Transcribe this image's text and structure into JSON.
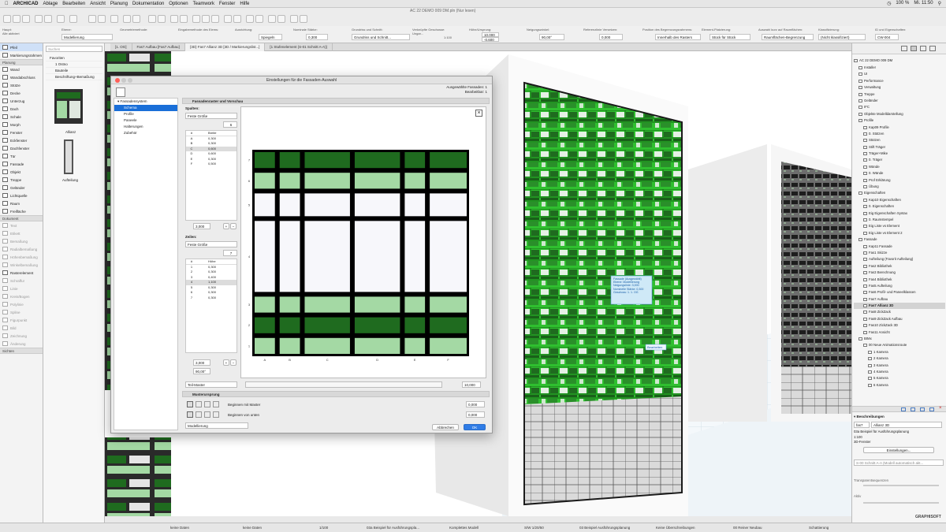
{
  "menubar": {
    "app": "ARCHICAD",
    "items": [
      "Ablage",
      "Bearbeiten",
      "Ansicht",
      "Planung",
      "Dokumentation",
      "Optionen",
      "Teamwork",
      "Fenster",
      "Hilfe"
    ],
    "battery": "100 %",
    "time": "Mi. 11:50"
  },
  "toolbar": {
    "doc_title": "AC 22 DEMO 009 DM.pln (Nur lesen)"
  },
  "infobox": {
    "header_main": "Haupt:",
    "main_value": "Alle aktiviert",
    "ebene_label": "Ebene:",
    "ebene_value": "Modellierung",
    "geom_label": "Geometriemethode:",
    "einsetz_label": "Eingabemethode des Elems:",
    "ausricht_label": "Ausrichtung:",
    "ausricht_value": "Spiegeln",
    "nominal_label": "Nominale Stärke:",
    "nominal_value": "0,300",
    "grundriss_label": "Grundriss und Schnitt:",
    "grundriss_value": "Grundriss und Schnitt...",
    "verknuepfte_label": "Verknüpfte Geschosse:",
    "verknuepfte_value": "Ungar...",
    "massstab_value": "1:100",
    "hoehe_label": "Höhe/Ursprung:",
    "hoehe_value": "10,000",
    "hoehe_value2": "-0,600",
    "neigung_label": "Neigungswinkel:",
    "neigung_value": "90,00°",
    "versatz_label": "Referenzlinie Versetzen:",
    "versatz_value": "0,000",
    "position_label": "Position des Begrenzungsrahmens:",
    "position_value": "Innerhalb des Rasters",
    "platzierung_label": "Element-Platzierung:",
    "platzierung_value": "Stück für Stück",
    "auswahl_label": "Auswahl kurz auf Raumflächen:",
    "auswahl_value": "Raumflächen-Begrenzung",
    "klass_label": "Klassifizierung:",
    "klass_value": "(Nicht klassifiziert)",
    "id_label": "ID und Eigenschaften:",
    "id_value": "CW-004"
  },
  "tabs": [
    {
      "label": "[1. OG]",
      "active": false
    },
    {
      "label": "Fas7 Aufbau [Fas7 Aufbau]",
      "active": false
    },
    {
      "label": "{3D} Fas7 Allianz 3D [3D / Markierungslist...]",
      "active": true
    },
    {
      "label": "[1 Stufenelement (S-01 Schnitt A-A)]",
      "active": false
    }
  ],
  "toolbox": {
    "sections": [
      {
        "title": "",
        "items": [
          {
            "label": "Pfeil",
            "selected": true
          },
          {
            "label": "Markierungsrahmen",
            "dim": false
          }
        ]
      },
      {
        "title": "Planung",
        "items": [
          {
            "label": "Wand"
          },
          {
            "label": "Wandabschluss"
          },
          {
            "label": "Stütze"
          },
          {
            "label": "Decke"
          },
          {
            "label": "Unterzug"
          },
          {
            "label": "Dach"
          },
          {
            "label": "Schale"
          },
          {
            "label": "Morph"
          },
          {
            "label": "Fenster"
          },
          {
            "label": "Eckfenster"
          },
          {
            "label": "Dachfenster"
          },
          {
            "label": "Tür"
          },
          {
            "label": "Fassade"
          },
          {
            "label": "Objekt"
          },
          {
            "label": "Treppe"
          },
          {
            "label": "Geländer"
          },
          {
            "label": "Lichtquelle"
          },
          {
            "label": "Raum"
          },
          {
            "label": "Freifläche"
          }
        ]
      },
      {
        "title": "Dokument",
        "items": [
          {
            "label": "Text",
            "dim": true
          },
          {
            "label": "Etikett",
            "dim": true
          },
          {
            "label": "Bemaßung",
            "dim": true
          },
          {
            "label": "Radialbemaßung",
            "dim": true
          },
          {
            "label": "Höhenbemaßung",
            "dim": true
          },
          {
            "label": "Winkelbemaßung",
            "dim": true
          },
          {
            "label": "Rasterelement"
          },
          {
            "label": "Schraffur",
            "dim": true
          },
          {
            "label": "Linie",
            "dim": true
          },
          {
            "label": "Kreis/Bogen",
            "dim": true
          },
          {
            "label": "Polylinie",
            "dim": true
          },
          {
            "label": "Spline",
            "dim": true
          },
          {
            "label": "Figurpunkt",
            "dim": true
          },
          {
            "label": "Bild",
            "dim": true
          },
          {
            "label": "Zeichnung",
            "dim": true
          },
          {
            "label": "Änderung",
            "dim": true
          }
        ]
      },
      {
        "title": "Sichten",
        "items": []
      }
    ]
  },
  "favorites": {
    "search_placeholder": "Suchen",
    "items": [
      "Favoriten",
      "1 Ostno",
      "Bauteile",
      "Beschriftung+Bemaßung"
    ],
    "thumb1_label": "Allianz",
    "thumb2_label": "Aufteilung",
    "bottom_label": "anwenden"
  },
  "dialog": {
    "title": "Einstellungen für die Fassaden-Auswahl",
    "selected_label": "Ausgewählte Fassaden: 1",
    "editable_label": "Bearbeitbar: 1",
    "tree_root": "Fassadensystem",
    "tree_items": [
      "Schema",
      "Profile",
      "Paneele",
      "Halterungen",
      "Zubehör"
    ],
    "section_title": "Fassadenraster und Vorschau",
    "spalten_label": "Spalten:",
    "spalten_mode": "Feste Größe",
    "spalten_count": "6",
    "col_table_headers": [
      "#",
      "Breite"
    ],
    "col_rows": [
      [
        "A",
        "0,300"
      ],
      [
        "B",
        "0,300"
      ],
      [
        "C",
        "0,600"
      ],
      [
        "D",
        "0,600"
      ],
      [
        "E",
        "0,300"
      ],
      [
        "F",
        "0,500"
      ]
    ],
    "col_total": "3,000",
    "zeilen_label": "Zeilen:",
    "zeilen_mode": "Feste Größe",
    "zeilen_count": "7",
    "row_table_headers": [
      "#",
      "Höhe"
    ],
    "row_rows": [
      [
        "1",
        "0,300"
      ],
      [
        "2",
        "0,300"
      ],
      [
        "3",
        "0,400"
      ],
      [
        "4",
        "1,100"
      ],
      [
        "5",
        "0,300"
      ],
      [
        "6",
        "0,300"
      ],
      [
        "7",
        "0,300"
      ]
    ],
    "row_total": "3,000",
    "angle_value": "90,00°",
    "col_axis": [
      "A",
      "B",
      "C",
      "D",
      "E",
      "F"
    ],
    "row_axis": [
      "7",
      "6",
      "5",
      "4",
      "3",
      "2",
      "1"
    ],
    "teil_label": "Teil-Master",
    "height_value": "10,000",
    "muster_title": "Musterursprung",
    "begin_master": "Beginnen mit Master",
    "begin_unten": "Beginnen von unten",
    "offset1": "0,000",
    "offset2": "0,000",
    "ebene_value": "Modellierung",
    "cancel_label": "Abbrechen",
    "ok_label": "OK"
  },
  "viewport": {
    "tooltip_lines": [
      "Fassade (Ausgewählt)",
      "Ebene: Modellierung",
      "Neigungslinie: 3,000",
      "Nominelle Stärke: 0,300",
      "Geschoss: 1. 1. OG"
    ],
    "edit_label": "Bearbeiten"
  },
  "navigator": {
    "root": "AC 22 DEMO 009 DM",
    "items": [
      {
        "label": "Installer",
        "level": 1
      },
      {
        "label": "UI",
        "level": 1
      },
      {
        "label": "Performance",
        "level": 1
      },
      {
        "label": "Verwaltung",
        "level": 1
      },
      {
        "label": "Treppe",
        "level": 1
      },
      {
        "label": "Geländer",
        "level": 1
      },
      {
        "label": "IFC",
        "level": 1
      },
      {
        "label": "Objekte Modelldarstellung",
        "level": 1
      },
      {
        "label": "Profile",
        "level": 1
      },
      {
        "label": "Kap09 Profile",
        "level": 2
      },
      {
        "label": "0. Stützen",
        "level": 2
      },
      {
        "label": "Stützen",
        "level": 2
      },
      {
        "label": "Stift Träger",
        "level": 2
      },
      {
        "label": "Träger+Mike",
        "level": 2
      },
      {
        "label": "0. Träger",
        "level": 2
      },
      {
        "label": "Wände",
        "level": 2
      },
      {
        "label": "0. Wände",
        "level": 2
      },
      {
        "label": "Prof Erklärung",
        "level": 2
      },
      {
        "label": "Übung",
        "level": 2
      },
      {
        "label": "Eigenschaften",
        "level": 1
      },
      {
        "label": "Kap10 Eigenschaften",
        "level": 2
      },
      {
        "label": "0. Eigenschaften",
        "level": 2
      },
      {
        "label": "Eig Eigenschaften Syntax",
        "level": 2
      },
      {
        "label": "0. Raumstempel",
        "level": 2
      },
      {
        "label": "Eig Liste vs Element",
        "level": 2
      },
      {
        "label": "Eig Liste vs Element 2",
        "level": 2
      },
      {
        "label": "Fassade",
        "level": 1
      },
      {
        "label": "Kap11 Fassade",
        "level": 2
      },
      {
        "label": "Fas1 Skizze",
        "level": 2
      },
      {
        "label": "Aufteilung (Favorit Aufteilung)",
        "level": 2
      },
      {
        "label": "Fas2 Bibliothek",
        "level": 2
      },
      {
        "label": "Fas3 Berechnung",
        "level": 2
      },
      {
        "label": "Fas4 Bibliothek",
        "level": 2
      },
      {
        "label": "Fas5 Aufteilung",
        "level": 2
      },
      {
        "label": "Fas6 Profil- und Paneelklassen",
        "level": 2
      },
      {
        "label": "Fas7 Aufbau",
        "level": 2
      },
      {
        "label": "Fas7 Allianz 3D",
        "level": 2,
        "selected": true
      },
      {
        "label": "Fas8 ZickZack",
        "level": 2
      },
      {
        "label": "Fas9 ZickZack Aufbau",
        "level": 2
      },
      {
        "label": "Fas10 ZickZack 3D",
        "level": 2
      },
      {
        "label": "Fas11 Ansicht",
        "level": 2
      },
      {
        "label": "BIMx",
        "level": 1
      },
      {
        "label": "00 Neue Animationsroute",
        "level": 2
      },
      {
        "label": "1 Kamera",
        "level": 3
      },
      {
        "label": "2 Kamera",
        "level": 3
      },
      {
        "label": "3 Kamera",
        "level": 3
      },
      {
        "label": "4 Kamera",
        "level": 3
      },
      {
        "label": "5 Kamera",
        "level": 3
      },
      {
        "label": "6 Kamera",
        "level": 3
      }
    ],
    "desc_title": "Beschreibungen",
    "desc_id": "fas7",
    "desc_name": "Allianz 3D",
    "desc_line1": "03a Beispiel für Ausführungsplanung",
    "desc_line2": "1:100",
    "desc_line3": "3D-Fenster",
    "einstellungen": "Einstellungen...",
    "schnitt_label": "S-00 Schnitt A-A (Modell automatisch akt...",
    "transparenz": "Transparentsequenzen",
    "aktiv": "Aktiv",
    "graphisoft": "GRAPHISOFT"
  },
  "statusbar": {
    "items": [
      "keine Daten",
      "keine Daten",
      "1/100",
      "03a Beispiel für Ausführungspla...",
      "Komplettes Modell",
      "S/W 1/20/50",
      "03 Beispiel Ausführungsplanung",
      "Keine Überschreibungen",
      "00 Reiner Neubau",
      "Schattierung"
    ]
  },
  "colors": {
    "facade_green": "#2fbf2f",
    "panel_dark": "#1f6b1f",
    "panel_light": "#a4d9a4",
    "accent_blue": "#1a6fd8"
  }
}
